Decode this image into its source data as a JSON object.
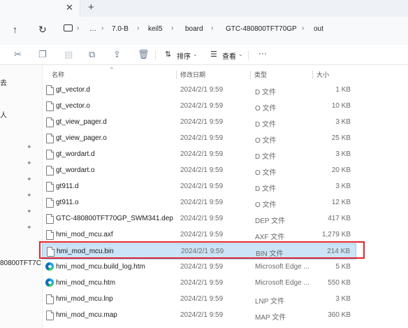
{
  "tabs": {
    "close": "✕",
    "new": "+"
  },
  "nav": {
    "up": "↑",
    "refresh": "↻",
    "more": "…"
  },
  "breadcrumb": [
    "7.0-B",
    "keil5",
    "board",
    "GTC-480800TFT70GP",
    "out"
  ],
  "toolbar": {
    "sort_label": "排序",
    "view_label": "查看",
    "more": "···"
  },
  "navpane": {
    "item1": "去",
    "item2": "人",
    "item3": "80800TFT7C"
  },
  "columns": {
    "name": "名称",
    "date": "修改日期",
    "type": "类型",
    "size": "大小"
  },
  "files": [
    {
      "name": "gt_vector.d",
      "date": "2024/2/1 9:59",
      "type": "D 文件",
      "size": "1 KB",
      "icon": "file-icon"
    },
    {
      "name": "gt_vector.o",
      "date": "2024/2/1 9:59",
      "type": "O 文件",
      "size": "10 KB",
      "icon": "file-icon"
    },
    {
      "name": "gt_view_pager.d",
      "date": "2024/2/1 9:59",
      "type": "D 文件",
      "size": "3 KB",
      "icon": "file-icon"
    },
    {
      "name": "gt_view_pager.o",
      "date": "2024/2/1 9:59",
      "type": "O 文件",
      "size": "25 KB",
      "icon": "file-icon"
    },
    {
      "name": "gt_wordart.d",
      "date": "2024/2/1 9:59",
      "type": "D 文件",
      "size": "3 KB",
      "icon": "file-icon"
    },
    {
      "name": "gt_wordart.o",
      "date": "2024/2/1 9:59",
      "type": "O 文件",
      "size": "20 KB",
      "icon": "file-icon"
    },
    {
      "name": "gt911.d",
      "date": "2024/2/1 9:59",
      "type": "D 文件",
      "size": "3 KB",
      "icon": "file-icon"
    },
    {
      "name": "gt911.o",
      "date": "2024/2/1 9:59",
      "type": "O 文件",
      "size": "12 KB",
      "icon": "file-icon"
    },
    {
      "name": "GTC-480800TFT70GP_SWM341.dep",
      "date": "2024/2/1 9:59",
      "type": "DEP 文件",
      "size": "417 KB",
      "icon": "file-icon"
    },
    {
      "name": "hmi_mod_mcu.axf",
      "date": "2024/2/1 9:59",
      "type": "AXF 文件",
      "size": "1,279 KB",
      "icon": "file-icon"
    },
    {
      "name": "hmi_mod_mcu.bin",
      "date": "2024/2/1 9:59",
      "type": "BIN 文件",
      "size": "214 KB",
      "icon": "file-icon"
    },
    {
      "name": "hmi_mod_mcu.build_log.htm",
      "date": "2024/2/1 9:59",
      "type": "Microsoft Edge ...",
      "size": "5 KB",
      "icon": "edge-icon"
    },
    {
      "name": "hmi_mod_mcu.htm",
      "date": "2024/2/1 9:59",
      "type": "Microsoft Edge ...",
      "size": "550 KB",
      "icon": "edge-icon"
    },
    {
      "name": "hmi_mod_mcu.lnp",
      "date": "2024/2/1 9:59",
      "type": "LNP 文件",
      "size": "3 KB",
      "icon": "file-icon"
    },
    {
      "name": "hmi_mod_mcu.map",
      "date": "2024/2/1 9:59",
      "type": "MAP 文件",
      "size": "360 KB",
      "icon": "file-icon"
    }
  ],
  "selected_index": 10,
  "colors": {
    "selection": "#cce4f7",
    "highlight_box": "#e1242a"
  }
}
